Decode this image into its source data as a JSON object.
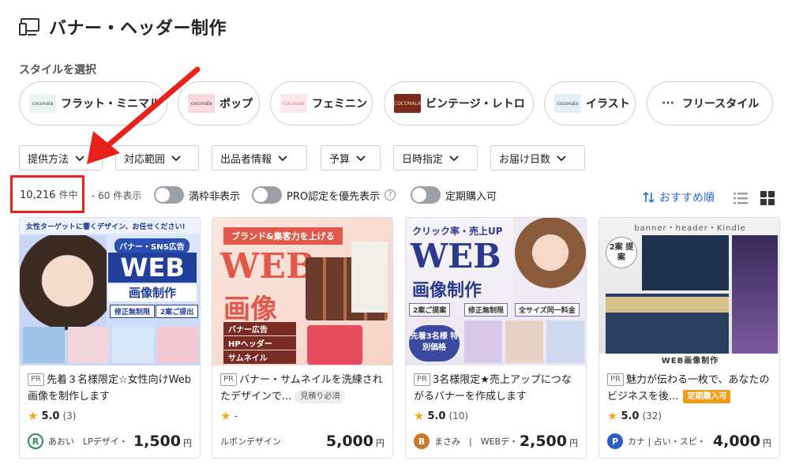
{
  "page": {
    "title": "バナー・ヘッダー制作",
    "style_select_label": "スタイルを選択"
  },
  "styles": [
    {
      "label": "フラット・ミニマル",
      "thumb_text": "coconala",
      "thumb_color": "#e8f6f1",
      "icon": "flat-thumbnail"
    },
    {
      "label": "ポップ",
      "thumb_text": "coconala",
      "thumb_color": "#fbd7e0",
      "icon": "pop-thumbnail"
    },
    {
      "label": "フェミニン",
      "thumb_text": "Coconala",
      "thumb_color": "#fbe9ec",
      "icon": "feminine-thumbnail"
    },
    {
      "label": "ビンテージ・レトロ",
      "thumb_text": "COCONALA",
      "thumb_color": "#7a2a1a",
      "icon": "vintage-thumbnail"
    },
    {
      "label": "イラスト",
      "thumb_text": "coconala",
      "thumb_color": "#e3eef8",
      "icon": "illust-thumbnail"
    },
    {
      "label": "フリースタイル",
      "thumb_text": "···",
      "thumb_color": "#ffffff",
      "icon": "more-icon"
    }
  ],
  "filters": [
    "提供方法",
    "対応範囲",
    "出品者情報",
    "予算",
    "日時指定",
    "お届け日数"
  ],
  "results": {
    "count": "10,216",
    "count_unit": "件中",
    "range": "- 60 件表示"
  },
  "toggles": [
    {
      "label": "満枠非表示",
      "on": false
    },
    {
      "label": "PRO認定を優先表示",
      "on": false,
      "help": "?"
    },
    {
      "label": "定期購入可",
      "on": false
    }
  ],
  "sort": {
    "label": "おすすめ順",
    "icon": "sort-icon"
  },
  "view_modes": [
    "list-view-icon",
    "grid-view-icon"
  ],
  "cards": [
    {
      "pr": "PR",
      "title": "先着３名様限定☆女性向けWeb画像を制作します",
      "tag": "",
      "rating": "5.0",
      "rating_count": "(3)",
      "avatar_letter": "R",
      "avatar_color": "#2e8b57",
      "seller": "あおい　LPデザイ・",
      "price": "1,500",
      "yen": "円",
      "banner": {
        "top": "女性ターゲットに響くデザイン、お任せください!",
        "mid": "バナー・SNS広告",
        "main": "WEB",
        "sub": "画像制作",
        "chip1": "修正無制限",
        "chip2": "2案ご提出"
      }
    },
    {
      "pr": "PR",
      "title": "バナー・サムネイルを洗練されたデザインで...",
      "tag": "見積り必須",
      "rating": "",
      "rating_count": "-",
      "avatar_letter": "",
      "avatar_color": "",
      "seller": "ルボンデザイン",
      "price": "5,000",
      "yen": "円",
      "banner": {
        "top": "ブランド&集客力を上げる",
        "main": "WEB",
        "sub": "画像",
        "l1": "バナー広告",
        "l2": "HPヘッダー",
        "l3": "サムネイル"
      }
    },
    {
      "pr": "PR",
      "title": "3名様限定★売上アップにつながるバナーを作成します",
      "tag": "",
      "rating": "5.0",
      "rating_count": "(10)",
      "avatar_letter": "B",
      "avatar_color": "#b5651d",
      "seller": "まさみ　|　WEBデ・",
      "price": "2,500",
      "yen": "円",
      "banner": {
        "top": "クリック率・売上UP",
        "main": "WEB",
        "sub": "画像制作",
        "c1": "2案ご提案",
        "c2": "修正無制限",
        "c3": "全サイズ同一料金",
        "badge": "先着3名様 特別価格"
      }
    },
    {
      "pr": "PR",
      "title": "魅力が伝わる一枚で、あなたのビジネスを後...",
      "tag": "定期購入可",
      "rating": "5.0",
      "rating_count": "(32)",
      "avatar_letter": "P",
      "avatar_color": "#2a5cc4",
      "seller": "カナ | 占い・スピ・",
      "price": "4,000",
      "yen": "円",
      "banner": {
        "top": "banner・header・Kindle",
        "badge": "2案 提案",
        "foot": "WEB画像制作"
      }
    }
  ]
}
